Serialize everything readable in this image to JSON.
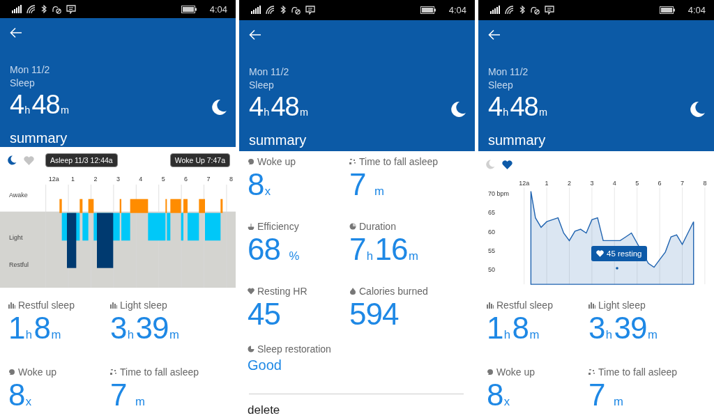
{
  "screens": [
    {
      "kind": "stages",
      "status_bar": {
        "time": "4:04"
      },
      "header": {
        "date": "Mon 11/2",
        "title": "Sleep",
        "duration": "4$_{h}$48$_{m}$",
        "section": "summary"
      },
      "toggles": [
        {
          "kind": "moon",
          "selected": true
        },
        {
          "kind": "heart",
          "selected": false
        }
      ],
      "timeline": {
        "asleep": "Asleep 11/3 12:44a",
        "woke": "Woke Up 7:47a",
        "hours": [
          "12a",
          "1",
          "2",
          "3",
          "4",
          "5",
          "6",
          "7",
          "8"
        ],
        "stages": [
          "Awake",
          "Light",
          "Restful"
        ]
      },
      "stats": [
        {
          "kind": "bars",
          "label": "Restful sleep",
          "value": "1$_{h}$8$_{m}$"
        },
        {
          "kind": "bars",
          "label": "Light sleep",
          "value": "3$_{h}$39$_{m}$"
        },
        {
          "kind": "wake",
          "label": "Woke up",
          "value": "8$_{x}$"
        },
        {
          "kind": "latency",
          "label": "Time to fall asleep",
          "value": "7 $_{m}$"
        }
      ]
    },
    {
      "kind": "details",
      "status_bar": {
        "time": "4:04"
      },
      "header": {
        "date": "Mon 11/2",
        "title": "Sleep",
        "duration": "4$_{h}$48$_{m}$",
        "section": "summary"
      },
      "stats": [
        {
          "kind": "wake",
          "label": "Woke up",
          "value": "8$_{x}$"
        },
        {
          "kind": "latency",
          "label": "Time to fall asleep",
          "value": "7 $_{m}$"
        },
        {
          "kind": "efficiency",
          "label": "Efficiency",
          "value": "68 $_{%}$"
        },
        {
          "kind": "duration",
          "label": "Duration",
          "value": "7$_{h}$16$_{m}$"
        },
        {
          "kind": "heart",
          "label": "Resting HR",
          "value": "45"
        },
        {
          "kind": "calories",
          "label": "Calories burned",
          "value": "594"
        },
        {
          "kind": "restoration",
          "label": "Sleep restoration",
          "value": "Good"
        }
      ],
      "action": "delete"
    },
    {
      "kind": "heart",
      "status_bar": {
        "time": "4:04"
      },
      "header": {
        "date": "Mon 11/2",
        "title": "Sleep",
        "duration": "4$_{h}$48$_{m}$",
        "section": "summary"
      },
      "toggles": [
        {
          "kind": "moon",
          "selected": false
        },
        {
          "kind": "heart",
          "selected": true
        }
      ],
      "hr_chart": {
        "tooltip": "45 resting",
        "start_label": "12a",
        "chart_data": {
          "type": "area",
          "grid": true,
          "xlim": [
            0,
            8
          ],
          "ylim": [
            46.5,
            72
          ],
          "xticks": [
            1,
            2,
            3,
            4,
            5,
            6,
            7,
            8
          ],
          "yticks": [
            50,
            55,
            60,
            65,
            {
              "value": 70,
              "label": "70 bpm"
            }
          ],
          "x": [
            0.3,
            0.5,
            0.75,
            1,
            1.25,
            1.5,
            1.75,
            2,
            2.25,
            2.5,
            2.75,
            3,
            3.25,
            3.5,
            3.75,
            4,
            4.25,
            4.5,
            4.75,
            5,
            5.25,
            5.5,
            5.75,
            6,
            6.25,
            6.5,
            6.75,
            7,
            7.25,
            7.5
          ],
          "series": [
            {
              "color": "#1f63b0",
              "values": [
                71,
                64,
                61.5,
                63,
                63.5,
                64,
                60,
                58,
                60.5,
                61,
                60,
                63.5,
                64,
                58,
                null,
                null,
                58,
                59,
                60,
                null,
                null,
                52,
                51,
                53,
                55,
                59,
                59.5,
                57,
                60,
                63
              ]
            }
          ]
        }
      },
      "stats": [
        {
          "kind": "bars",
          "label": "Restful sleep",
          "value": "1$_{h}$8$_{m}$"
        },
        {
          "kind": "bars",
          "label": "Light sleep",
          "value": "3$_{h}$39$_{m}$"
        },
        {
          "kind": "wake",
          "label": "Woke up",
          "value": "8$_{x}$"
        },
        {
          "kind": "latency",
          "label": "Time to fall asleep",
          "value": "7 $_{m}$"
        }
      ]
    }
  ]
}
